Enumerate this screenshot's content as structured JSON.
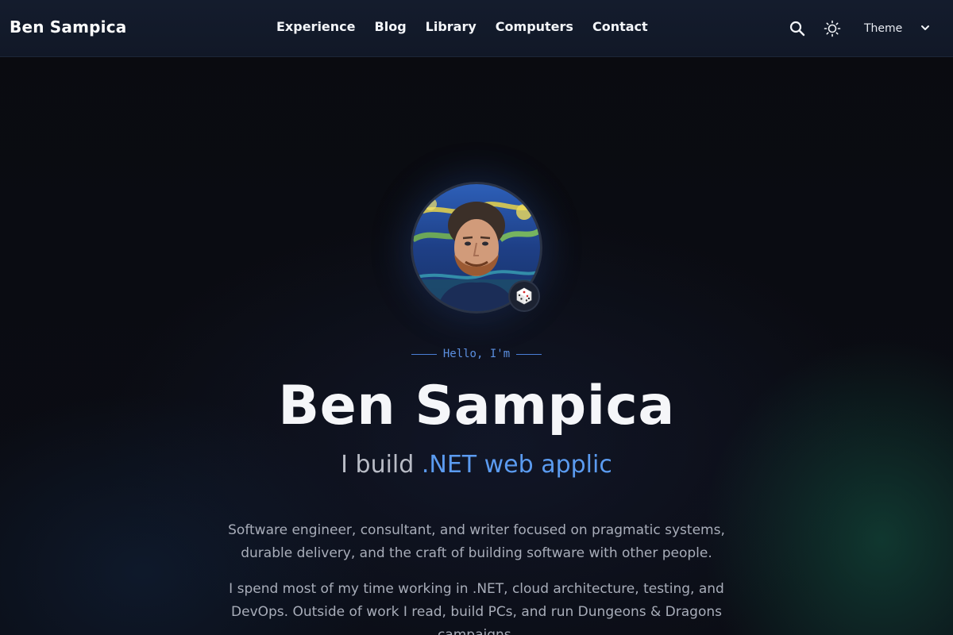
{
  "header": {
    "brand": "Ben Sampica",
    "nav": [
      "Experience",
      "Blog",
      "Library",
      "Computers",
      "Contact"
    ],
    "theme_label": "Theme",
    "icons": [
      "search-icon",
      "sun-icon",
      "chevron-down-icon"
    ]
  },
  "hero": {
    "greeting": "Hello, I'm",
    "name": "Ben Sampica",
    "tagline_prefix": "I build",
    "tagline_accent": ".NET web applic",
    "para1": "Software engineer, consultant, and writer focused on pragmatic systems, durable delivery, and the craft of building software with other people.",
    "para2": "I spend most of my time working in .NET, cloud architecture, testing, and DevOps. Outside of work I read, build PCs, and run Dungeons & Dragons campaigns."
  },
  "colors": {
    "accent": "#5b9bf0",
    "header_bg": "#111827",
    "page_bg": "#0a0b10"
  }
}
